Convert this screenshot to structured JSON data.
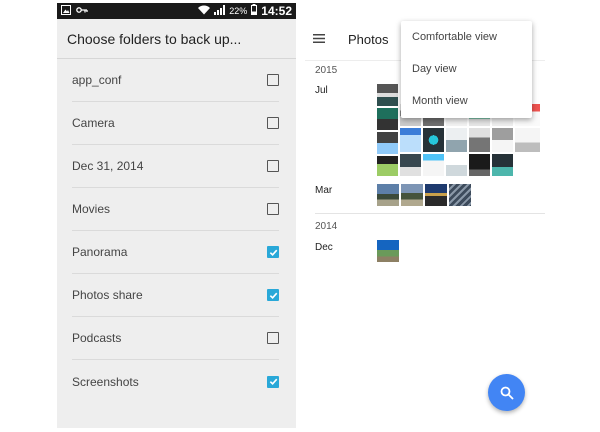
{
  "left": {
    "status": {
      "battery": "22%",
      "clock": "14:52"
    },
    "title": "Choose folders to back up...",
    "folders": [
      {
        "label": "app_conf",
        "checked": false
      },
      {
        "label": "Camera",
        "checked": false
      },
      {
        "label": "Dec 31, 2014",
        "checked": false
      },
      {
        "label": "Movies",
        "checked": false
      },
      {
        "label": "Panorama",
        "checked": true
      },
      {
        "label": "Photos share",
        "checked": true
      },
      {
        "label": "Podcasts",
        "checked": false
      },
      {
        "label": "Screenshots",
        "checked": true
      }
    ]
  },
  "right": {
    "title": "Photos",
    "menu": {
      "options": [
        "Comfortable view",
        "Day view",
        "Month view"
      ]
    },
    "years": [
      "2015",
      "2014"
    ],
    "months": [
      "Jul",
      "Mar",
      "Dec"
    ],
    "fab_icon": "search-icon"
  },
  "colors": {
    "checkbox_accent": "#29a8d8",
    "fab_blue": "#4285f4",
    "statusbar": "#1a1a1a"
  }
}
